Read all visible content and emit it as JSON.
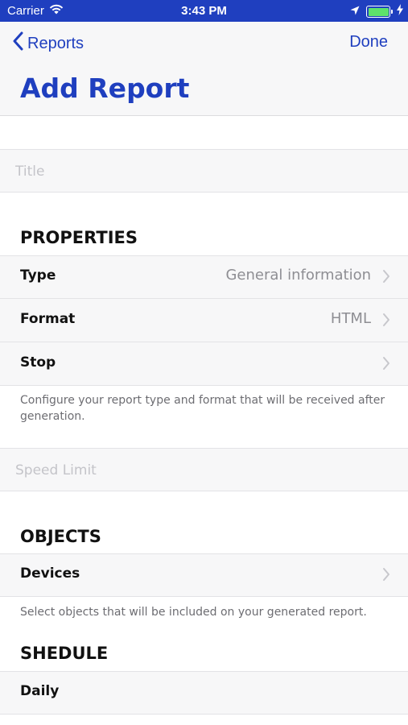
{
  "status_bar": {
    "carrier": "Carrier",
    "time": "3:43 PM",
    "battery_level": 1.0
  },
  "nav": {
    "back_label": "Reports",
    "done_label": "Done",
    "title": "Add Report"
  },
  "title_field": {
    "placeholder": "Title",
    "value": ""
  },
  "properties": {
    "header": "PROPERTIES",
    "rows": [
      {
        "label": "Type",
        "value": "General information"
      },
      {
        "label": "Format",
        "value": "HTML"
      },
      {
        "label": "Stop",
        "value": ""
      }
    ],
    "footer": "Configure your report type and format that will be received after generation."
  },
  "speed_field": {
    "placeholder": "Speed Limit",
    "value": ""
  },
  "objects": {
    "header": "OBJECTS",
    "rows": [
      {
        "label": "Devices",
        "value": ""
      }
    ],
    "footer": "Select objects that will be included on your generated report."
  },
  "schedule": {
    "header": "SHEDULE",
    "rows": [
      {
        "label": "Daily"
      }
    ]
  },
  "colors": {
    "accent": "#1f3fbf",
    "battery": "#5ee26b"
  }
}
